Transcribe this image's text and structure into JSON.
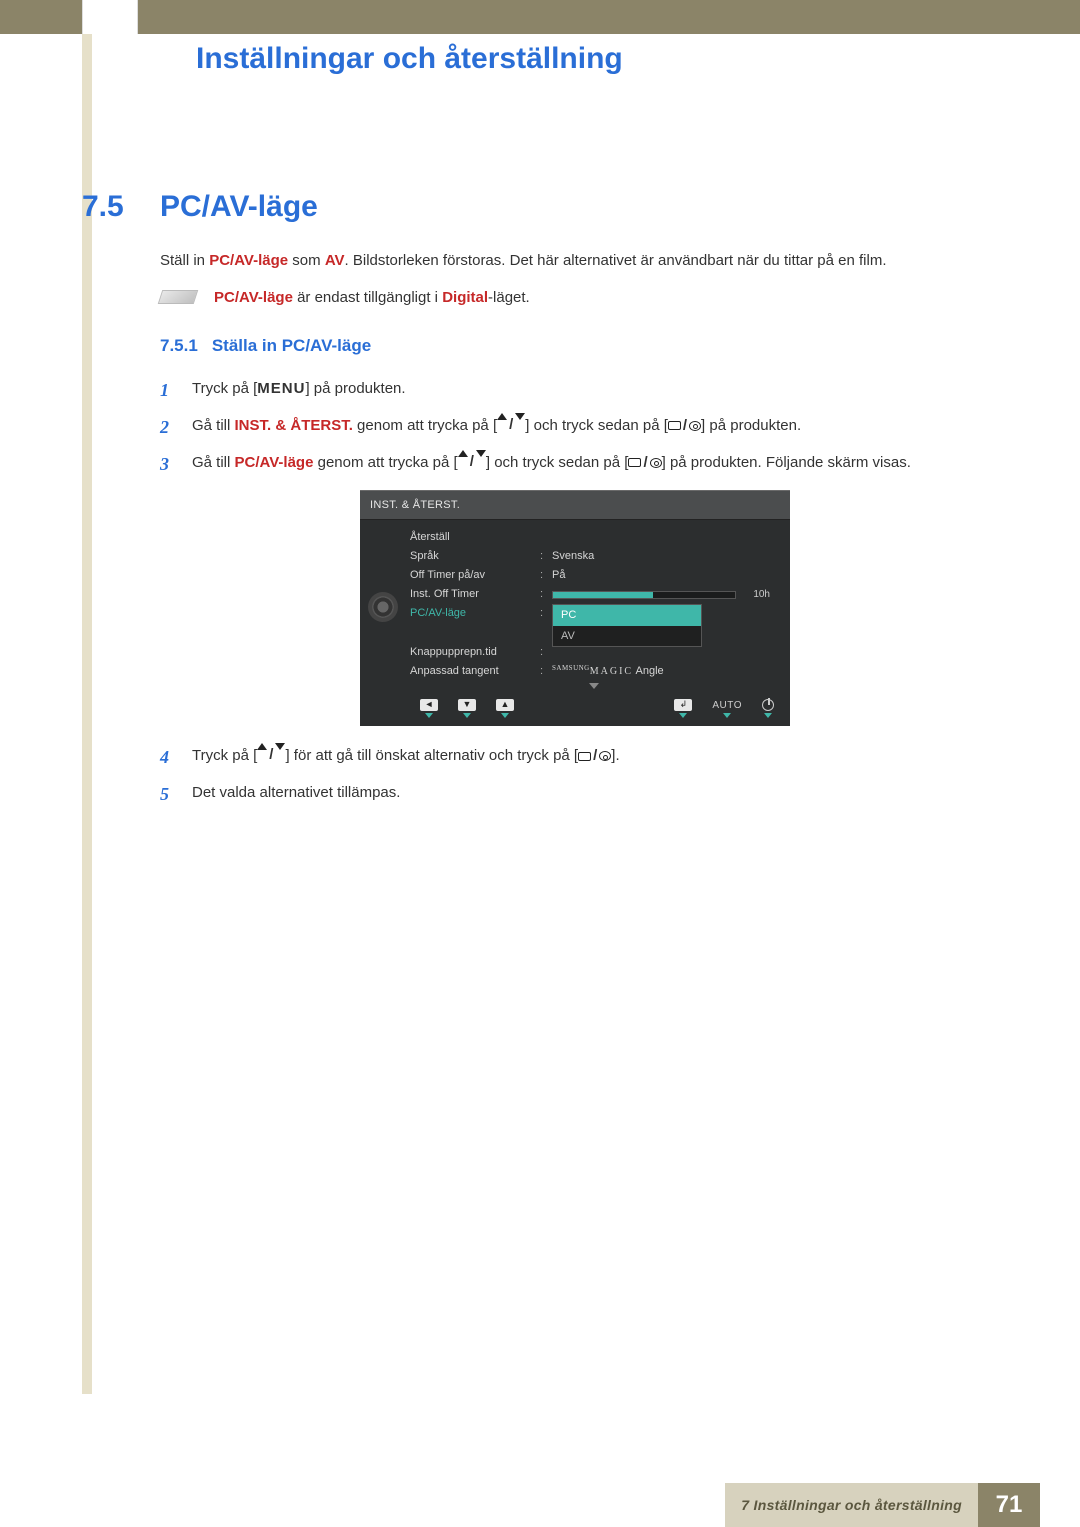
{
  "header": {
    "chapter_title": "Inställningar och återställning"
  },
  "section": {
    "number": "7.5",
    "title": "PC/AV-läge"
  },
  "intro": {
    "prefix": "Ställ in ",
    "term1": "PC/AV-läge",
    "mid": " som ",
    "term2": "AV",
    "suffix": ". Bildstorleken förstoras. Det här alternativet är användbart när du tittar på en film."
  },
  "note": {
    "term": "PC/AV-läge",
    "mid": " är endast tillgängligt i ",
    "digital": "Digital",
    "suffix": "-läget."
  },
  "subsection": {
    "number": "7.5.1",
    "title": "Ställa in PC/AV-läge"
  },
  "steps": {
    "s1": {
      "num": "1",
      "pre": "Tryck på [",
      "menu": "MENU",
      "post": "] på produkten."
    },
    "s2": {
      "num": "2",
      "pre": "Gå till ",
      "term": "INST. & ÅTERST.",
      "mid": " genom att trycka på [",
      "mid2": "] och tryck sedan på [",
      "post": "] på produkten."
    },
    "s3": {
      "num": "3",
      "pre": "Gå till ",
      "term": "PC/AV-läge",
      "mid": " genom att trycka på [",
      "mid2": "] och tryck sedan på [",
      "post": "] på produkten. Följande skärm visas."
    },
    "s4": {
      "num": "4",
      "pre": "Tryck på [",
      "mid": "] för att gå till önskat alternativ och tryck på [",
      "post": "]."
    },
    "s5": {
      "num": "5",
      "text": "Det valda alternativet tillämpas."
    }
  },
  "osd": {
    "title": "INST. & ÅTERST.",
    "rows": {
      "reset": {
        "label": "Återställ",
        "value": ""
      },
      "lang": {
        "label": "Språk",
        "value": "Svenska"
      },
      "offtimer": {
        "label": "Off Timer på/av",
        "value": "På"
      },
      "instoff": {
        "label": "Inst. Off Timer",
        "slider_text": "10h"
      },
      "pcav": {
        "label": "PC/AV-läge",
        "options": [
          "PC",
          "AV"
        ],
        "selected": 0
      },
      "keyrep": {
        "label": "Knappupprepn.tid",
        "value": ""
      },
      "customkey": {
        "label": "Anpassad tangent",
        "value_brand": "SAMSUNG",
        "value_magic": "MAGIC",
        "value_suffix": " Angle"
      }
    },
    "footer_auto": "AUTO"
  },
  "footer": {
    "label": "7 Inställningar och återställning",
    "page": "71"
  }
}
